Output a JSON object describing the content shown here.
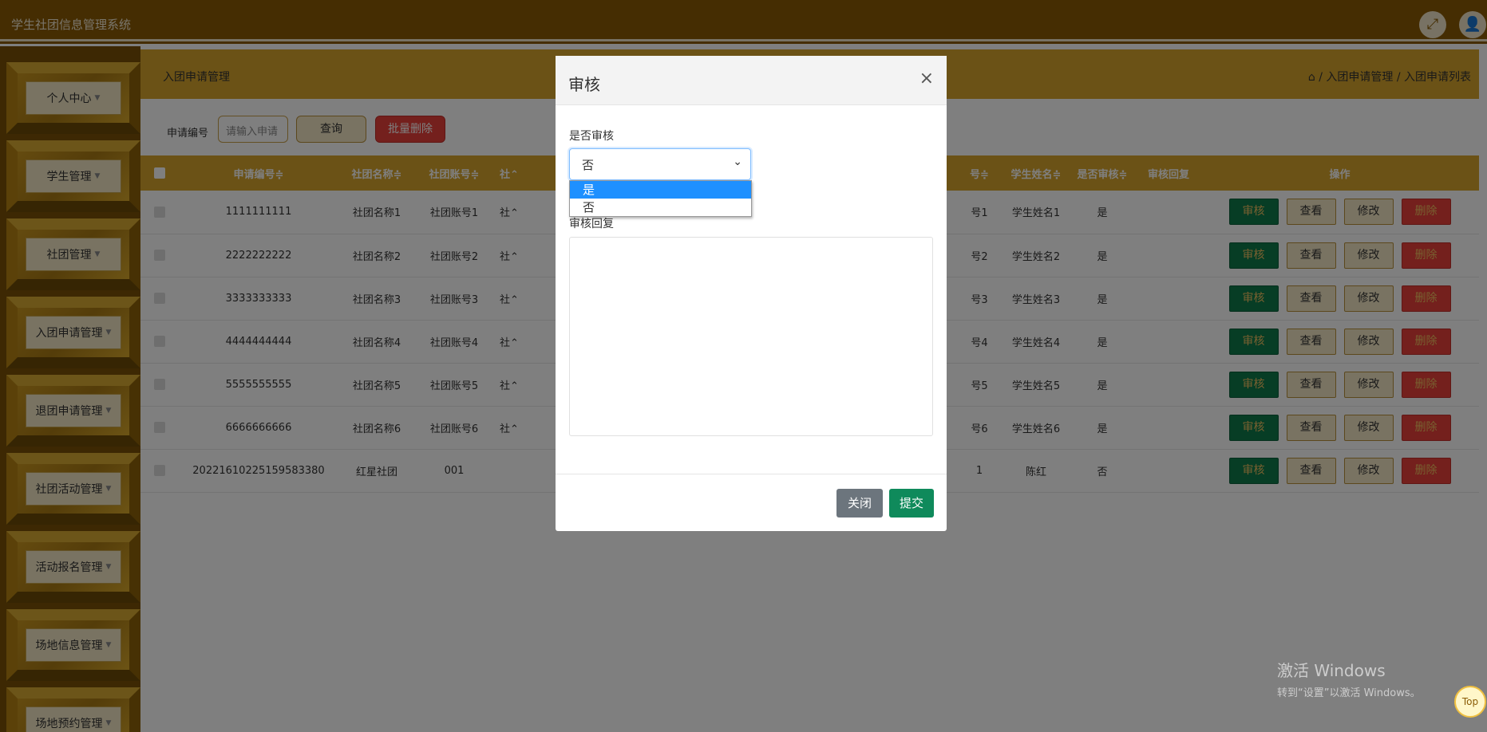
{
  "app": {
    "title": "学生社团信息管理系统"
  },
  "topbar": {
    "fullscreen_icon": "⤢",
    "user_icon": "👤"
  },
  "sidebar": {
    "items": [
      {
        "label": "个人中心"
      },
      {
        "label": "学生管理"
      },
      {
        "label": "社团管理"
      },
      {
        "label": "入团申请管理"
      },
      {
        "label": "退团申请管理"
      },
      {
        "label": "社团活动管理"
      },
      {
        "label": "活动报名管理"
      },
      {
        "label": "场地信息管理"
      },
      {
        "label": "场地预约管理"
      }
    ],
    "caret": "▼"
  },
  "header": {
    "page_title": "入团申请管理",
    "breadcrumb": "⌂ / 入团申请管理 / 入团申请列表"
  },
  "search": {
    "label": "申请编号",
    "placeholder": "请输入申请",
    "query_label": "查询",
    "bulk_delete_label": "批量删除"
  },
  "table": {
    "headers": [
      "申请编号≑",
      "社团名称≑",
      "社团账号≑",
      "社⌃",
      "号≑",
      "学生姓名≑",
      "是否审核≑",
      "审核回复",
      "操作"
    ],
    "rows": [
      {
        "id": "1111111111",
        "club": "社团名称1",
        "acct": "社团账号1",
        "c4": "社⌃",
        "c5": "号1",
        "student": "学生姓名1",
        "audited": "是"
      },
      {
        "id": "2222222222",
        "club": "社团名称2",
        "acct": "社团账号2",
        "c4": "社⌃",
        "c5": "号2",
        "student": "学生姓名2",
        "audited": "是"
      },
      {
        "id": "3333333333",
        "club": "社团名称3",
        "acct": "社团账号3",
        "c4": "社⌃",
        "c5": "号3",
        "student": "学生姓名3",
        "audited": "是"
      },
      {
        "id": "4444444444",
        "club": "社团名称4",
        "acct": "社团账号4",
        "c4": "社⌃",
        "c5": "号4",
        "student": "学生姓名4",
        "audited": "是"
      },
      {
        "id": "5555555555",
        "club": "社团名称5",
        "acct": "社团账号5",
        "c4": "社⌃",
        "c5": "号5",
        "student": "学生姓名5",
        "audited": "是"
      },
      {
        "id": "6666666666",
        "club": "社团名称6",
        "acct": "社团账号6",
        "c4": "社⌃",
        "c5": "号6",
        "student": "学生姓名6",
        "audited": "是"
      },
      {
        "id": "20221610225159583380",
        "club": "红星社团",
        "acct": "001",
        "c4": "",
        "c5": "1",
        "student": "陈红",
        "audited": "否"
      }
    ],
    "actions": {
      "audit": "审核",
      "view": "查看",
      "edit": "修改",
      "delete": "删除"
    }
  },
  "modal": {
    "title": "审核",
    "close_icon": "×",
    "audit_label": "是否审核",
    "select_value": "否",
    "select_arrow": "⌄",
    "options": [
      "是",
      "否"
    ],
    "highlighted_option": "是",
    "reply_label": "审核回复",
    "reply_value": "",
    "close_button": "关闭",
    "submit_button": "提交"
  },
  "watermark": {
    "line1": "激活 Windows",
    "line2": "转到“设置”以激活 Windows。"
  },
  "top_button": "Top",
  "colors": {
    "brand_dark": "#8a5b05",
    "brand": "#d7a52c",
    "audit_green": "#0f7a4b",
    "danger": "#e8403a",
    "select_blue": "#1e90ff"
  }
}
